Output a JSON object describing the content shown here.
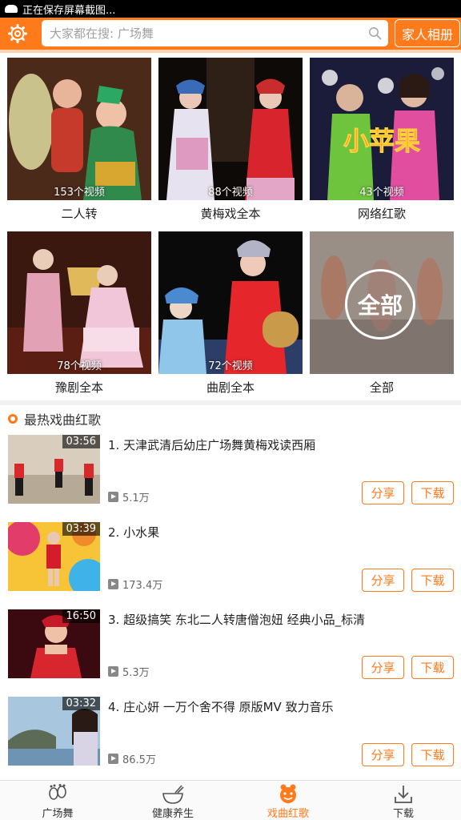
{
  "status_bar": {
    "text": "正在保存屏幕截图..."
  },
  "header": {
    "search_placeholder": "大家都在搜: 广场舞",
    "family_album_label": "家人相册"
  },
  "categories": [
    {
      "label": "二人转",
      "count": "153个视频"
    },
    {
      "label": "黄梅戏全本",
      "count": "88个视频"
    },
    {
      "label": "网络红歌",
      "count": "43个视频",
      "overlay_text": "小苹果"
    },
    {
      "label": "豫剧全本",
      "count": "78个视频"
    },
    {
      "label": "曲剧全本",
      "count": "72个视频"
    },
    {
      "label": "全部",
      "circle_text": "全部"
    }
  ],
  "hot_section": {
    "title": "最热戏曲红歌"
  },
  "videos": [
    {
      "title": "1. 天津武清后幼庄广场舞黄梅戏读西厢",
      "duration": "03:56",
      "plays": "5.1万",
      "share": "分享",
      "download": "下载"
    },
    {
      "title": "2. 小水果",
      "duration": "03:39",
      "plays": "173.4万",
      "share": "分享",
      "download": "下载"
    },
    {
      "title": "3. 超级搞笑 东北二人转唐僧泡妞 经典小品_标清",
      "duration": "16:50",
      "plays": "5.3万",
      "share": "分享",
      "download": "下载"
    },
    {
      "title": "4. 庄心妍 一万个舍不得 原版MV  致力音乐",
      "duration": "03:32",
      "plays": "86.5万",
      "share": "分享",
      "download": "下载"
    }
  ],
  "bottom_nav": [
    {
      "label": "广场舞",
      "icon": "footprints-icon",
      "active": false
    },
    {
      "label": "健康养生",
      "icon": "bowl-icon",
      "active": false
    },
    {
      "label": "戏曲红歌",
      "icon": "opera-mask-icon",
      "active": true
    },
    {
      "label": "下载",
      "icon": "download-icon",
      "active": false
    }
  ],
  "colors": {
    "accent": "#ff7a1a"
  }
}
